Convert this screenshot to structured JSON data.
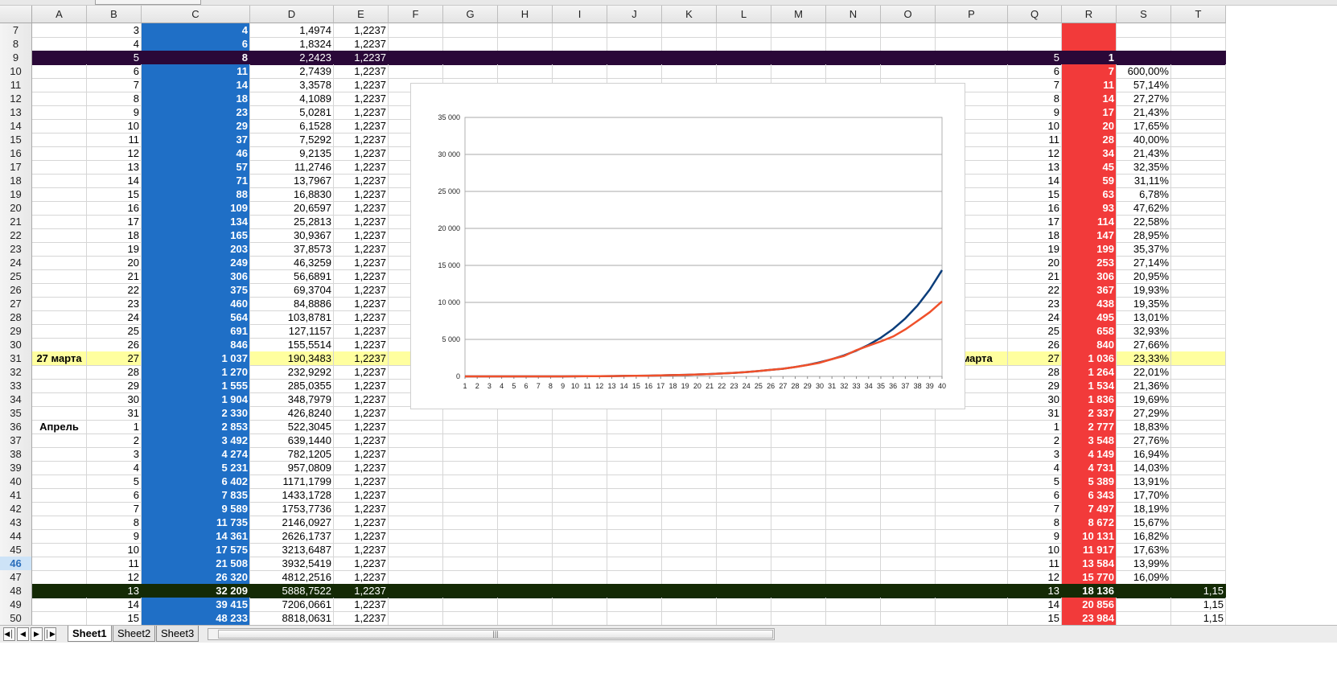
{
  "columns": [
    "A",
    "B",
    "C",
    "D",
    "E",
    "F",
    "G",
    "H",
    "I",
    "J",
    "K",
    "L",
    "M",
    "N",
    "O",
    "P",
    "Q",
    "R",
    "S",
    "T"
  ],
  "active_row": 46,
  "rows": [
    {
      "n": 7,
      "B": "3",
      "C": "4",
      "D": "1,4974",
      "E": "1,2237",
      "Q": "",
      "R": "",
      "S": "",
      "T": ""
    },
    {
      "n": 8,
      "B": "4",
      "C": "6",
      "D": "1,8324",
      "E": "1,2237",
      "Q": "",
      "R": "",
      "S": "",
      "T": ""
    },
    {
      "n": 9,
      "B": "5",
      "C": "8",
      "D": "2,2423",
      "E": "1,2237",
      "Q": "5",
      "R": "1",
      "S": "",
      "T": "",
      "style": "purple"
    },
    {
      "n": 10,
      "B": "6",
      "C": "11",
      "D": "2,7439",
      "E": "1,2237",
      "Q": "6",
      "R": "7",
      "S": "600,00%",
      "T": ""
    },
    {
      "n": 11,
      "B": "7",
      "C": "14",
      "D": "3,3578",
      "E": "1,2237",
      "Q": "7",
      "R": "11",
      "S": "57,14%",
      "T": ""
    },
    {
      "n": 12,
      "B": "8",
      "C": "18",
      "D": "4,1089",
      "E": "1,2237",
      "Q": "8",
      "R": "14",
      "S": "27,27%",
      "T": ""
    },
    {
      "n": 13,
      "B": "9",
      "C": "23",
      "D": "5,0281",
      "E": "1,2237",
      "Q": "9",
      "R": "17",
      "S": "21,43%",
      "T": ""
    },
    {
      "n": 14,
      "B": "10",
      "C": "29",
      "D": "6,1528",
      "E": "1,2237",
      "Q": "10",
      "R": "20",
      "S": "17,65%",
      "T": ""
    },
    {
      "n": 15,
      "B": "11",
      "C": "37",
      "D": "7,5292",
      "E": "1,2237",
      "Q": "11",
      "R": "28",
      "S": "40,00%",
      "T": ""
    },
    {
      "n": 16,
      "B": "12",
      "C": "46",
      "D": "9,2135",
      "E": "1,2237",
      "Q": "12",
      "R": "34",
      "S": "21,43%",
      "T": ""
    },
    {
      "n": 17,
      "B": "13",
      "C": "57",
      "D": "11,2746",
      "E": "1,2237",
      "Q": "13",
      "R": "45",
      "S": "32,35%",
      "T": ""
    },
    {
      "n": 18,
      "B": "14",
      "C": "71",
      "D": "13,7967",
      "E": "1,2237",
      "Q": "14",
      "R": "59",
      "S": "31,11%",
      "T": ""
    },
    {
      "n": 19,
      "B": "15",
      "C": "88",
      "D": "16,8830",
      "E": "1,2237",
      "Q": "15",
      "R": "63",
      "S": "6,78%",
      "T": ""
    },
    {
      "n": 20,
      "B": "16",
      "C": "109",
      "D": "20,6597",
      "E": "1,2237",
      "Q": "16",
      "R": "93",
      "S": "47,62%",
      "T": ""
    },
    {
      "n": 21,
      "B": "17",
      "C": "134",
      "D": "25,2813",
      "E": "1,2237",
      "Q": "17",
      "R": "114",
      "S": "22,58%",
      "T": ""
    },
    {
      "n": 22,
      "B": "18",
      "C": "165",
      "D": "30,9367",
      "E": "1,2237",
      "Q": "18",
      "R": "147",
      "S": "28,95%",
      "T": ""
    },
    {
      "n": 23,
      "B": "19",
      "C": "203",
      "D": "37,8573",
      "E": "1,2237",
      "Q": "19",
      "R": "199",
      "S": "35,37%",
      "T": ""
    },
    {
      "n": 24,
      "B": "20",
      "C": "249",
      "D": "46,3259",
      "E": "1,2237",
      "Q": "20",
      "R": "253",
      "S": "27,14%",
      "T": ""
    },
    {
      "n": 25,
      "B": "21",
      "C": "306",
      "D": "56,6891",
      "E": "1,2237",
      "Q": "21",
      "R": "306",
      "S": "20,95%",
      "T": ""
    },
    {
      "n": 26,
      "B": "22",
      "C": "375",
      "D": "69,3704",
      "E": "1,2237",
      "Q": "22",
      "R": "367",
      "S": "19,93%",
      "T": ""
    },
    {
      "n": 27,
      "B": "23",
      "C": "460",
      "D": "84,8886",
      "E": "1,2237",
      "Q": "23",
      "R": "438",
      "S": "19,35%",
      "T": ""
    },
    {
      "n": 28,
      "B": "24",
      "C": "564",
      "D": "103,8781",
      "E": "1,2237",
      "Q": "24",
      "R": "495",
      "S": "13,01%",
      "T": ""
    },
    {
      "n": 29,
      "B": "25",
      "C": "691",
      "D": "127,1157",
      "E": "1,2237",
      "Q": "25",
      "R": "658",
      "S": "32,93%",
      "T": ""
    },
    {
      "n": 30,
      "B": "26",
      "C": "846",
      "D": "155,5514",
      "E": "1,2237",
      "Q": "26",
      "R": "840",
      "S": "27,66%",
      "T": ""
    },
    {
      "n": 31,
      "A": "27 марта",
      "P": "27марта",
      "B": "27",
      "C": "1 037",
      "D": "190,3483",
      "E": "1,2237",
      "Q": "27",
      "R": "1 036",
      "S": "23,33%",
      "T": "",
      "style": "yellow"
    },
    {
      "n": 32,
      "B": "28",
      "C": "1 270",
      "D": "232,9292",
      "E": "1,2237",
      "Q": "28",
      "R": "1 264",
      "S": "22,01%",
      "T": ""
    },
    {
      "n": 33,
      "B": "29",
      "C": "1 555",
      "D": "285,0355",
      "E": "1,2237",
      "Q": "29",
      "R": "1 534",
      "S": "21,36%",
      "T": ""
    },
    {
      "n": 34,
      "B": "30",
      "C": "1 904",
      "D": "348,7979",
      "E": "1,2237",
      "Q": "30",
      "R": "1 836",
      "S": "19,69%",
      "T": ""
    },
    {
      "n": 35,
      "B": "31",
      "C": "2 330",
      "D": "426,8240",
      "E": "1,2237",
      "Q": "31",
      "R": "2 337",
      "S": "27,29%",
      "T": ""
    },
    {
      "n": 36,
      "A": "Апрель",
      "B": "1",
      "C": "2 853",
      "D": "522,3045",
      "E": "1,2237",
      "Q": "1",
      "R": "2 777",
      "S": "18,83%",
      "T": ""
    },
    {
      "n": 37,
      "B": "2",
      "C": "3 492",
      "D": "639,1440",
      "E": "1,2237",
      "Q": "2",
      "R": "3 548",
      "S": "27,76%",
      "T": ""
    },
    {
      "n": 38,
      "B": "3",
      "C": "4 274",
      "D": "782,1205",
      "E": "1,2237",
      "Q": "3",
      "R": "4 149",
      "S": "16,94%",
      "T": ""
    },
    {
      "n": 39,
      "B": "4",
      "C": "5 231",
      "D": "957,0809",
      "E": "1,2237",
      "Q": "4",
      "R": "4 731",
      "S": "14,03%",
      "T": ""
    },
    {
      "n": 40,
      "B": "5",
      "C": "6 402",
      "D": "1171,1799",
      "E": "1,2237",
      "Q": "5",
      "R": "5 389",
      "S": "13,91%",
      "T": ""
    },
    {
      "n": 41,
      "B": "6",
      "C": "7 835",
      "D": "1433,1728",
      "E": "1,2237",
      "Q": "6",
      "R": "6 343",
      "S": "17,70%",
      "T": ""
    },
    {
      "n": 42,
      "B": "7",
      "C": "9 589",
      "D": "1753,7736",
      "E": "1,2237",
      "Q": "7",
      "R": "7 497",
      "S": "18,19%",
      "T": ""
    },
    {
      "n": 43,
      "B": "8",
      "C": "11 735",
      "D": "2146,0927",
      "E": "1,2237",
      "Q": "8",
      "R": "8 672",
      "S": "15,67%",
      "T": ""
    },
    {
      "n": 44,
      "B": "9",
      "C": "14 361",
      "D": "2626,1737",
      "E": "1,2237",
      "Q": "9",
      "R": "10 131",
      "S": "16,82%",
      "T": ""
    },
    {
      "n": 45,
      "B": "10",
      "C": "17 575",
      "D": "3213,6487",
      "E": "1,2237",
      "Q": "10",
      "R": "11 917",
      "S": "17,63%",
      "T": ""
    },
    {
      "n": 46,
      "B": "11",
      "C": "21 508",
      "D": "3932,5419",
      "E": "1,2237",
      "Q": "11",
      "R": "13 584",
      "S": "13,99%",
      "T": ""
    },
    {
      "n": 47,
      "B": "12",
      "C": "26 320",
      "D": "4812,2516",
      "E": "1,2237",
      "Q": "12",
      "R": "15 770",
      "S": "16,09%",
      "T": ""
    },
    {
      "n": 48,
      "B": "13",
      "C": "32 209",
      "D": "5888,7522",
      "E": "1,2237",
      "Q": "13",
      "R": "18 136",
      "S": "",
      "T": "1,15",
      "style": "green"
    },
    {
      "n": 49,
      "B": "14",
      "C": "39 415",
      "D": "7206,0661",
      "E": "1,2237",
      "Q": "14",
      "R": "20 856",
      "S": "",
      "T": "1,15"
    },
    {
      "n": 50,
      "B": "15",
      "C": "48 233",
      "D": "8818,0631",
      "E": "1,2237",
      "Q": "15",
      "R": "23 984",
      "S": "",
      "T": "1,15"
    }
  ],
  "sheets": [
    "Sheet1",
    "Sheet2",
    "Sheet3"
  ],
  "active_sheet": "Sheet1",
  "colors": {
    "blue_fill": "#1f6fc6",
    "red_fill": "#f23a3a",
    "purple_row": "#2a0838",
    "green_row": "#142a05",
    "yellow_row": "#ffff9f",
    "series_blue": "#0b3d7a",
    "series_red": "#f0502a"
  },
  "chart_data": {
    "type": "line",
    "title": "",
    "xlabel": "",
    "ylabel": "",
    "x": [
      1,
      2,
      3,
      4,
      5,
      6,
      7,
      8,
      9,
      10,
      11,
      12,
      13,
      14,
      15,
      16,
      17,
      18,
      19,
      20,
      21,
      22,
      23,
      24,
      25,
      26,
      27,
      28,
      29,
      30,
      31,
      32,
      33,
      34,
      35,
      36,
      37,
      38,
      39,
      40
    ],
    "ylim": [
      0,
      35000
    ],
    "yticks": [
      "0",
      "5 000",
      "10 000",
      "15 000",
      "20 000",
      "25 000",
      "30 000",
      "35 000"
    ],
    "grid": true,
    "series": [
      {
        "color": "#0b3d7a",
        "values": [
          0,
          0,
          0,
          0,
          0,
          0,
          0,
          0,
          0,
          10,
          20,
          30,
          40,
          60,
          80,
          100,
          130,
          170,
          210,
          260,
          320,
          390,
          480,
          590,
          720,
          880,
          1037,
          1270,
          1555,
          1904,
          2330,
          2853,
          3492,
          4274,
          5231,
          6402,
          7835,
          9589,
          11735,
          14361,
          17575,
          21508,
          26320,
          32209
        ]
      },
      {
        "color": "#f0502a",
        "values": [
          0,
          0,
          0,
          0,
          0,
          0,
          0,
          0,
          0,
          10,
          20,
          30,
          40,
          60,
          80,
          100,
          130,
          170,
          210,
          260,
          320,
          390,
          480,
          590,
          720,
          880,
          1036,
          1264,
          1534,
          1836,
          2337,
          2777,
          3548,
          4149,
          4731,
          5389,
          6343,
          7497,
          8672,
          10131,
          11917,
          13584,
          15770,
          18136
        ]
      }
    ]
  }
}
